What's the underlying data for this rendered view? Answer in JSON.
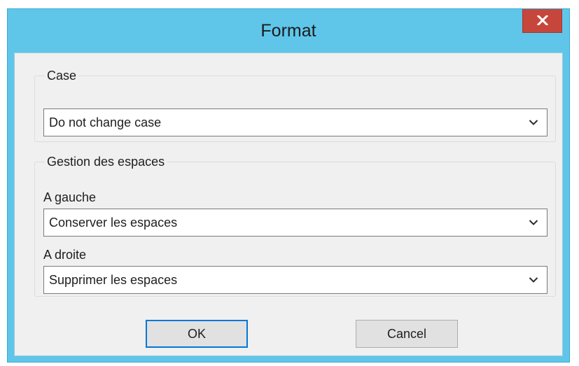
{
  "window": {
    "title": "Format"
  },
  "case_group": {
    "legend": "Case",
    "select": {
      "selected": "Do not change case"
    }
  },
  "spaces_group": {
    "legend": "Gestion des espaces",
    "left": {
      "label": "A gauche",
      "selected": "Conserver les espaces"
    },
    "right": {
      "label": "A droite",
      "selected": "Supprimer les espaces"
    }
  },
  "buttons": {
    "ok": "OK",
    "cancel": "Cancel"
  },
  "colors": {
    "titlebar": "#5fc6ea",
    "close_button": "#c7463c",
    "client_bg": "#f0f0f0",
    "default_button_border": "#0078d7"
  },
  "icons": {
    "close": "close-icon",
    "dropdown": "chevron-down-icon"
  }
}
